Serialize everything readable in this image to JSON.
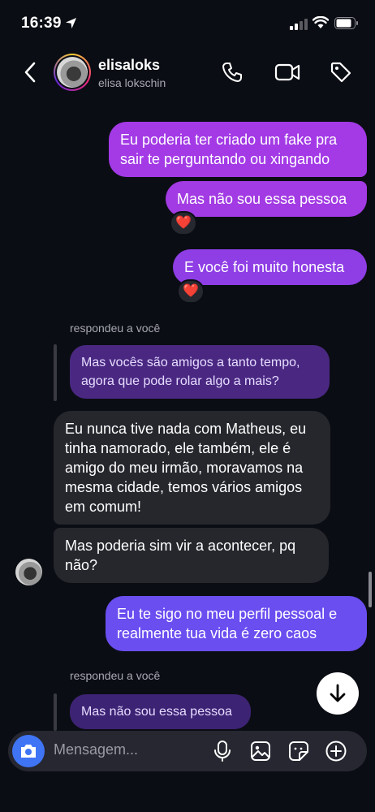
{
  "status_bar": {
    "time": "16:39"
  },
  "header": {
    "username": "elisaloks",
    "full_name": "elisa lokschin"
  },
  "messages": {
    "sent1": "Eu poderia ter criado um fake pra sair te perguntando ou xingando",
    "sent2": "Mas não sou essa pessoa",
    "reaction1": "❤️",
    "sent3": "E você foi muito honesta",
    "reaction2": "❤️",
    "reply_label1": "respondeu a você",
    "quoted1": "Mas vocês são amigos a tanto tempo, agora que pode rolar algo a mais?",
    "received1": "Eu nunca tive nada com Matheus, eu tinha namorado, ele também, ele é amigo do meu irmão, moravamos na mesma cidade, temos vários amigos em comum!",
    "received2": "Mas poderia sim vir a acontecer, pq não?",
    "sent4": "Eu te sigo no meu perfil pessoal e realmente tua vida é zero caos",
    "reply_label2": "respondeu a você",
    "quoted2": "Mas não sou essa pessoa"
  },
  "composer": {
    "placeholder": "Mensagem..."
  },
  "colors": {
    "background": "#0b0d14",
    "sent_purple": "#a33ae6",
    "sent_indigo": "#6a4ef0",
    "received": "#26272d",
    "camera_blue": "#3f74f5"
  },
  "icons": [
    "location-arrow-icon",
    "signal-icon",
    "wifi-icon",
    "battery-icon",
    "back-chevron-icon",
    "phone-icon",
    "video-camera-icon",
    "tag-icon",
    "arrow-down-icon",
    "camera-icon",
    "microphone-icon",
    "gallery-icon",
    "sticker-icon",
    "plus-icon"
  ]
}
